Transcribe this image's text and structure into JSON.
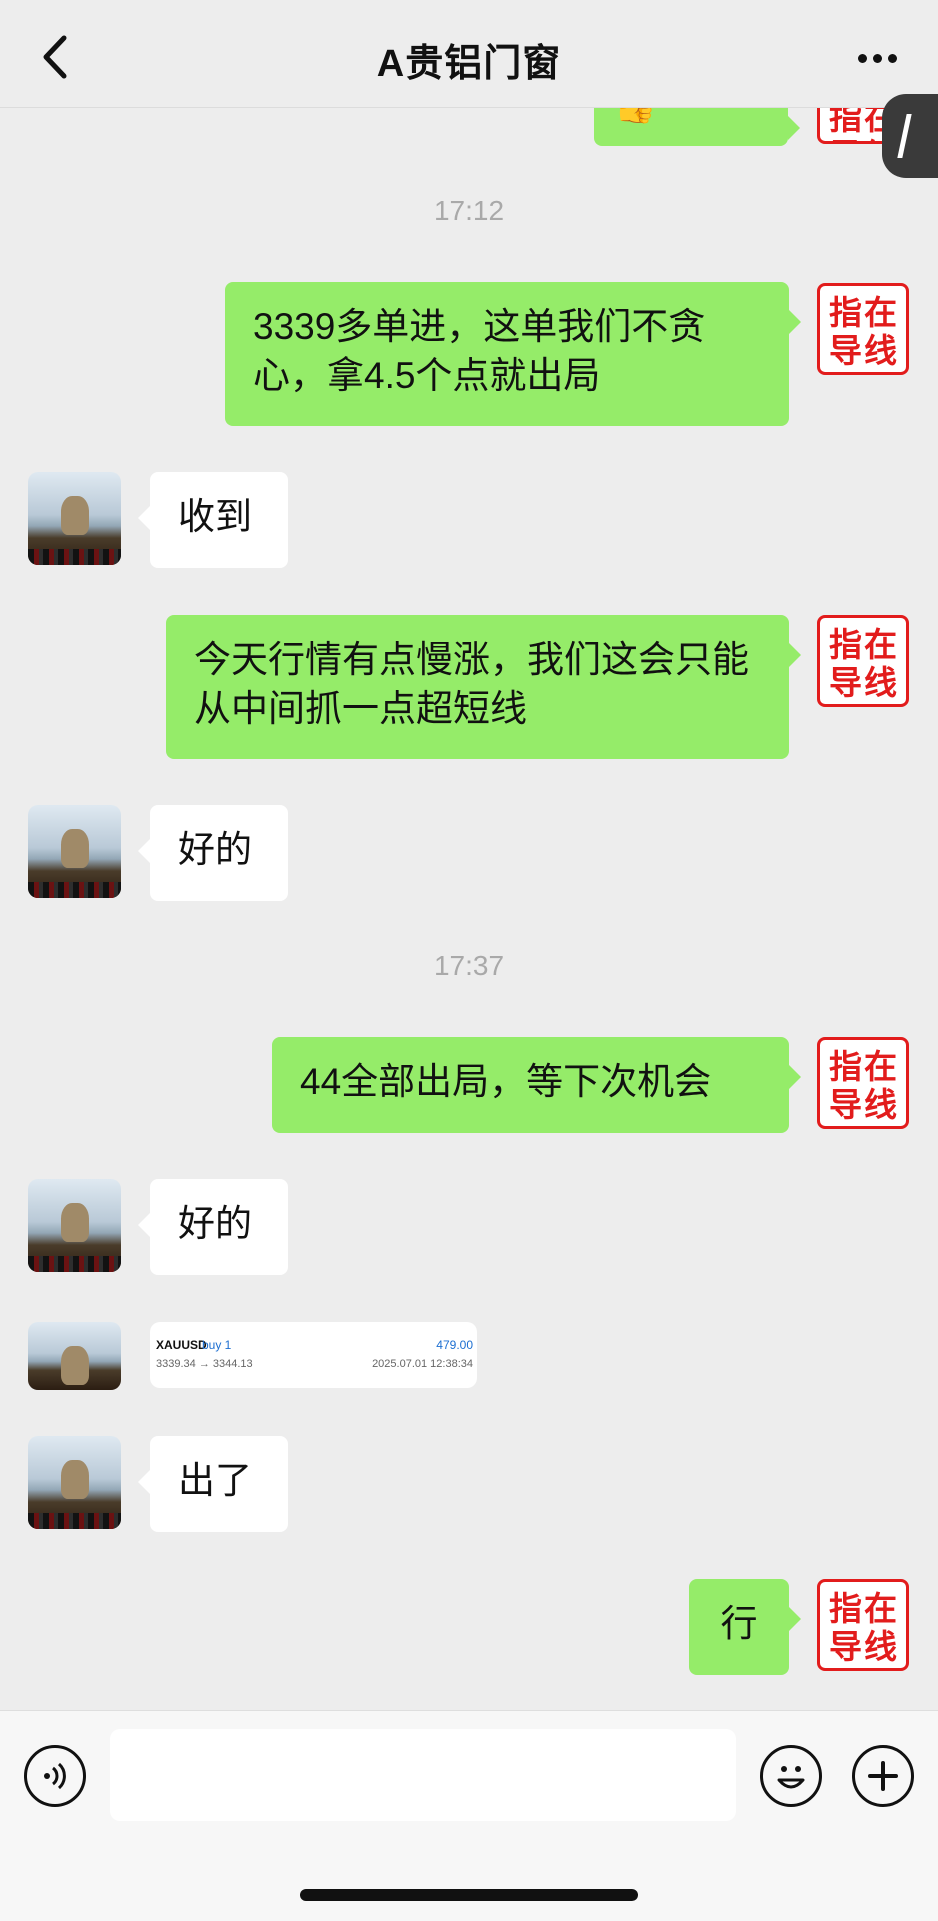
{
  "header": {
    "title": "A贵铝门窗",
    "back_icon": "chevron-left-icon",
    "more_icon": "more-dots-icon",
    "side_tab_icon": "chevron-left-icon"
  },
  "avatar_right": {
    "seal_text": [
      "指",
      "在",
      "导",
      "线"
    ]
  },
  "messages": {
    "partial": "",
    "ts1": "17:12",
    "m1": "3339多单进，这单我们不贪心，拿4.5个点就出局",
    "m2": "收到",
    "m3": "今天行情有点慢涨，我们这会只能从中间抓一点超短线",
    "m4": "好的",
    "ts2": "17:37",
    "m5": "44全部出局，等下次机会",
    "m6": "好的",
    "trade_card": {
      "symbol": "XAUUSD",
      "side": "buy 1",
      "profit": "479.00",
      "prices": "3339.34 → 3344.13",
      "datetime": "2025.07.01 12:38:34"
    },
    "m7": "出了",
    "m8": "行"
  },
  "composer": {
    "voice_icon": "voice-icon",
    "emoji_icon": "emoji-icon",
    "plus_icon": "plus-icon"
  }
}
